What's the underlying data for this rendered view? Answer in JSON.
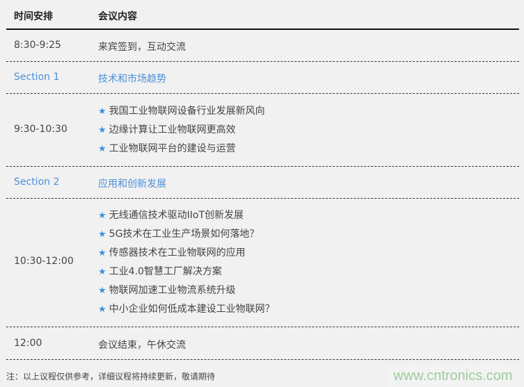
{
  "header": {
    "time_col": "时间安排",
    "content_col": "会议内容"
  },
  "rows": [
    {
      "time": "8:30-9:25",
      "content": "来宾签到，互动交流"
    },
    {
      "time": "Section 1",
      "content": "技术和市场趋势"
    },
    {
      "time": "9:30-10:30",
      "items": [
        "我国工业物联网设备行业发展新风向",
        "边缘计算让工业物联网更高效",
        "工业物联网平台的建设与运营"
      ]
    },
    {
      "time": "Section 2",
      "content": "应用和创新发展"
    },
    {
      "time": "10:30-12:00",
      "items": [
        "无线通信技术驱动IIoT创新发展",
        "5G技术在工业生产场景如何落地？",
        "传感器技术在工业物联网的应用",
        "工业4.0智慧工厂解决方案",
        "物联网加速工业物流系统升级",
        "中小企业如何低成本建设工业物联网？"
      ]
    },
    {
      "time": "12:00",
      "content": "会议结束，午休交流"
    }
  ],
  "star_icon": "★",
  "note": "注：以上议程仅供参考，详细议程将持续更新，敬请期待",
  "watermark": "www.cntronics.com",
  "colors": {
    "section": "#4a90d9",
    "star": "#3b8ee0",
    "watermark": "#9ccc9c"
  }
}
